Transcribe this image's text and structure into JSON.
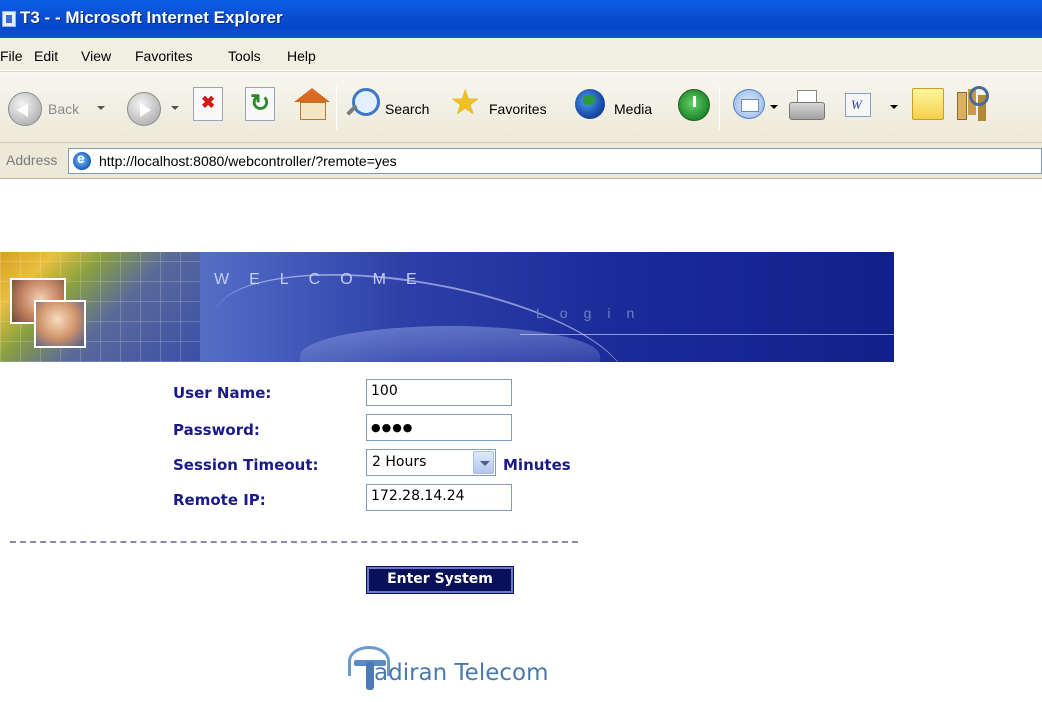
{
  "window": {
    "title": "T3 - - Microsoft Internet Explorer"
  },
  "menu": [
    "File",
    "Edit",
    "View",
    "Favorites",
    "Tools",
    "Help"
  ],
  "toolbar": {
    "back_label": "Back",
    "search_label": "Search",
    "favorites_label": "Favorites",
    "media_label": "Media"
  },
  "address": {
    "label": "Address",
    "url": "http://localhost:8080/webcontroller/?remote=yes"
  },
  "banner": {
    "welcome": "WELCOME",
    "login": "Login"
  },
  "form": {
    "username_label": "User Name:",
    "username_value": "100",
    "password_label": "Password:",
    "password_value": "●●●●",
    "timeout_label": "Session Timeout:",
    "timeout_value": "2 Hours",
    "timeout_unit": "Minutes",
    "remote_ip_label": "Remote IP:",
    "remote_ip_value": "172.28.14.24",
    "submit_label": "Enter System"
  },
  "logo": {
    "text": "adiran Telecom"
  },
  "icons": {
    "back": "back-arrow-icon",
    "forward": "forward-arrow-icon",
    "stop": "stop-icon",
    "refresh": "refresh-icon",
    "home": "home-icon",
    "search": "search-icon",
    "favorites": "star-icon",
    "media": "media-icon",
    "history": "history-icon",
    "mail": "mail-icon",
    "print": "printer-icon",
    "edit": "word-icon",
    "discuss": "note-icon",
    "research": "research-icon"
  }
}
